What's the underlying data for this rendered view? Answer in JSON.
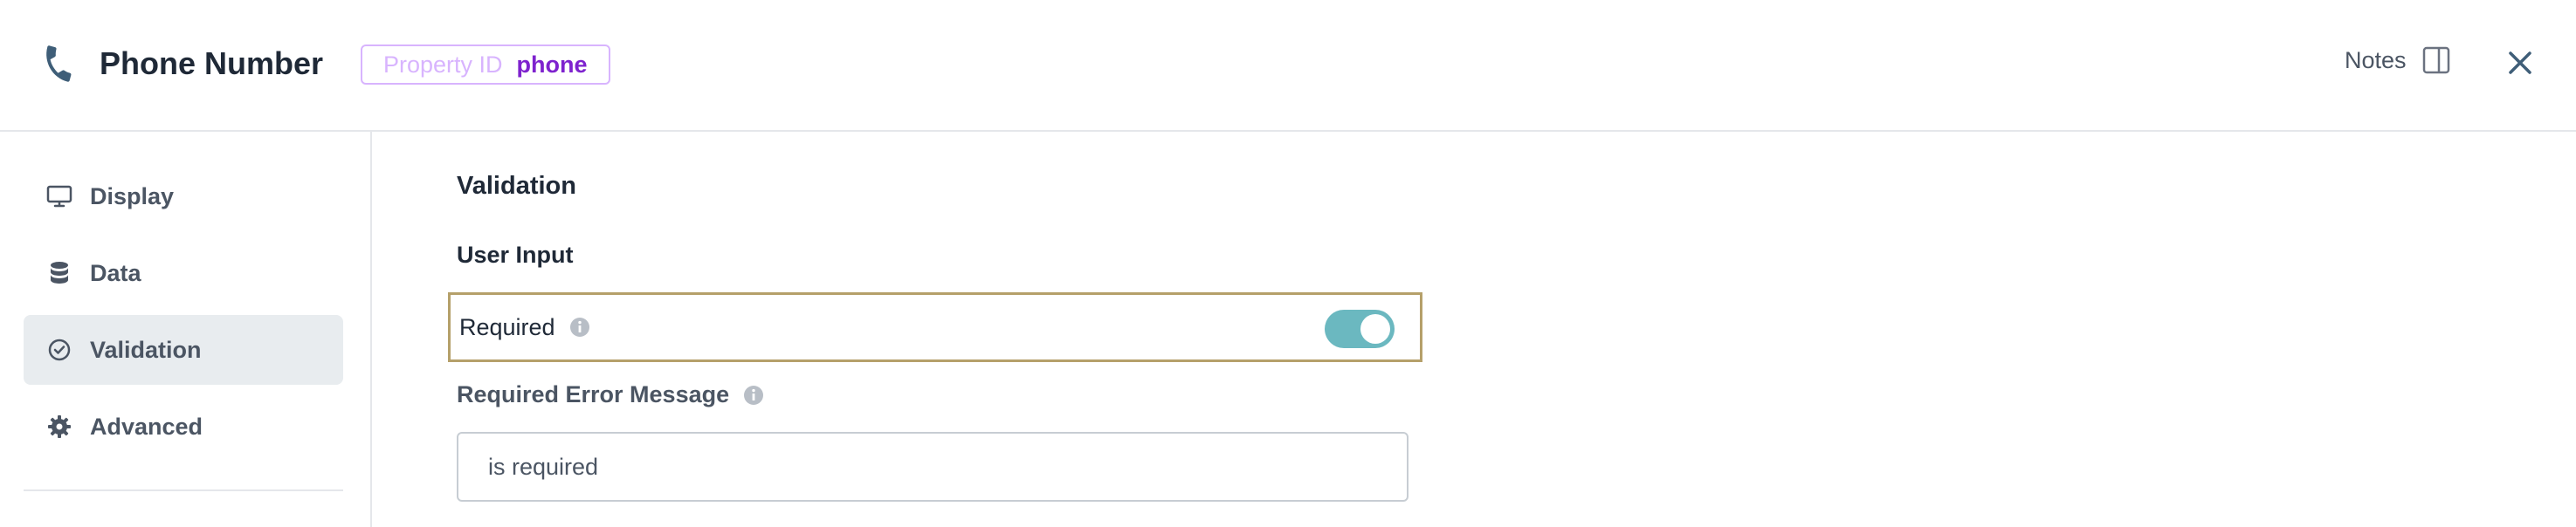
{
  "header": {
    "title": "Phone Number",
    "property_id_label": "Property ID",
    "property_id_value": "phone",
    "notes_label": "Notes",
    "icons": {
      "title": "phone-icon",
      "notes": "panel-icon",
      "close": "close-icon"
    }
  },
  "sidebar": {
    "items": [
      {
        "label": "Display",
        "icon": "monitor-icon",
        "active": false
      },
      {
        "label": "Data",
        "icon": "database-icon",
        "active": false
      },
      {
        "label": "Validation",
        "icon": "check-circle-icon",
        "active": true
      },
      {
        "label": "Advanced",
        "icon": "gear-icon",
        "active": false
      }
    ]
  },
  "main": {
    "section_title": "Validation",
    "subsection_title": "User Input",
    "required": {
      "label": "Required",
      "enabled": true
    },
    "error_message": {
      "label": "Required Error Message",
      "value": "is required"
    }
  },
  "colors": {
    "accent_purple": "#7e22ce",
    "badge_border": "#d8b4fe",
    "toggle_on": "#6bb8c0",
    "highlight_border": "#b5a06a",
    "active_nav_bg": "#e8ecef"
  }
}
